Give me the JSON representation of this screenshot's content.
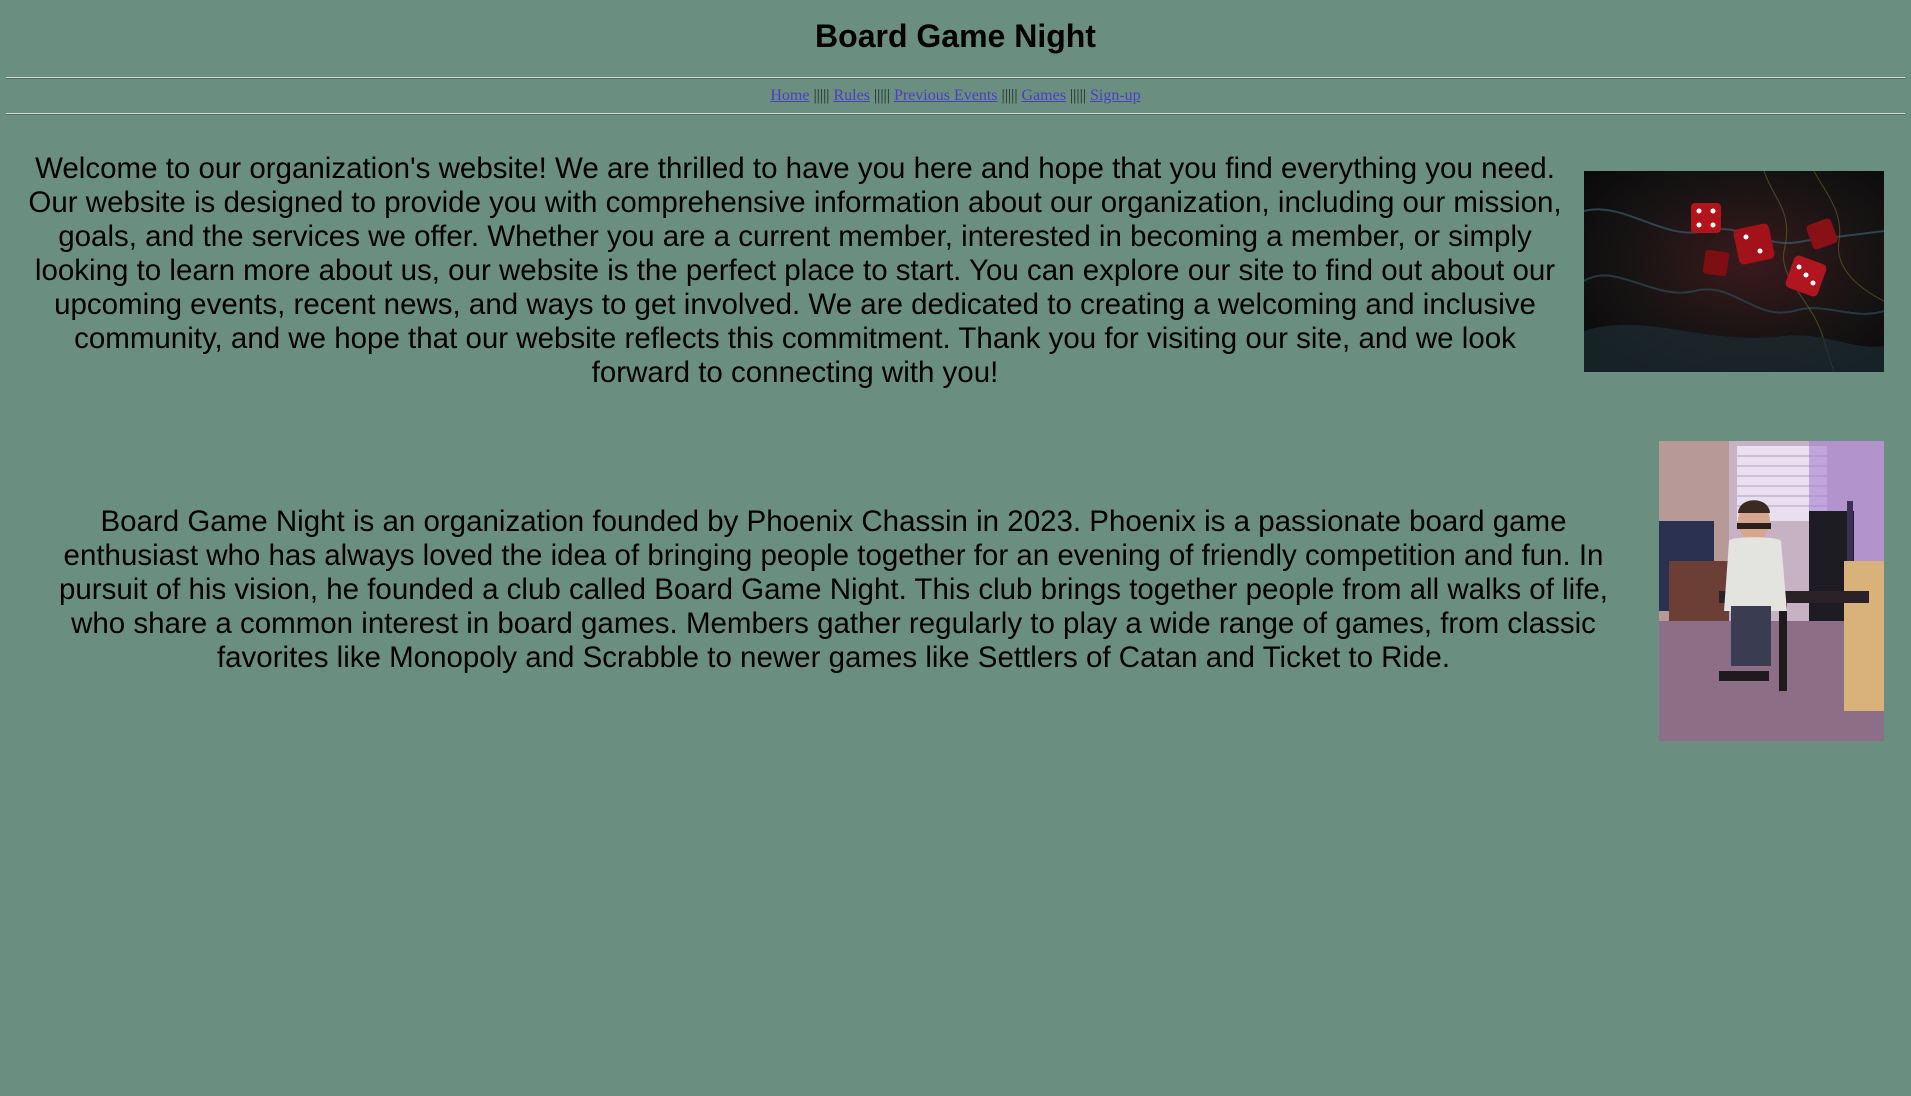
{
  "header": {
    "title": "Board Game Night"
  },
  "nav": {
    "items": [
      "Home",
      "Rules",
      "Previous Events",
      "Games",
      "Sign-up"
    ],
    "separator": "|||||"
  },
  "welcome": {
    "text": "Welcome to our organization's website! We are thrilled to have you here and hope that you find everything you need. Our website is designed to provide you with comprehensive information about our organization, including our mission, goals, and the services we offer. Whether you are a current member, interested in becoming a member, or simply looking to learn more about us, our website is the perfect place to start. You can explore our site to find out about our upcoming events, recent news, and ways to get involved. We are dedicated to creating a welcoming and inclusive community, and we hope that our website reflects this commitment. Thank you for visiting our site, and we look forward to connecting with you!"
  },
  "about": {
    "text": "Board Game Night is an organization founded by Phoenix Chassin in 2023. Phoenix is a passionate board game enthusiast who has always loved the idea of bringing people together for an evening of friendly competition and fun. In pursuit of his vision, he founded a club called Board Game Night. This club brings together people from all walks of life, who share a common interest in board games. Members gather regularly to play a wide range of games, from classic favorites like Monopoly and Scrabble to newer games like Settlers of Catan and Ticket to Ride."
  },
  "colors": {
    "background": "#6a8f80",
    "link": "#4b3fc0",
    "text": "#000000"
  }
}
